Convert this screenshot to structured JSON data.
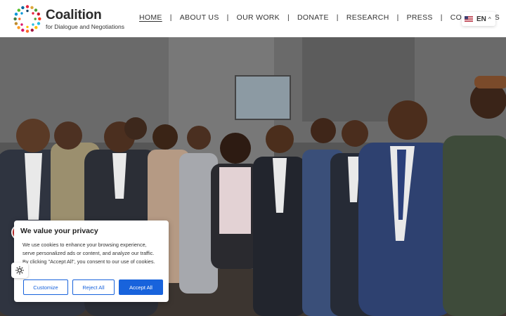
{
  "brand": {
    "title": "Coalition",
    "subtitle": "for Dialogue and Negotiations"
  },
  "nav": {
    "items": [
      {
        "label": "HOME",
        "active": true
      },
      {
        "label": "ABOUT US",
        "active": false
      },
      {
        "label": "OUR WORK",
        "active": false
      },
      {
        "label": "DONATE",
        "active": false
      },
      {
        "label": "RESEARCH",
        "active": false
      },
      {
        "label": "PRESS",
        "active": false
      },
      {
        "label": "CONTACT US",
        "active": false
      }
    ],
    "separator": "|"
  },
  "language": {
    "code": "EN",
    "flag_icon": "us-flag-icon",
    "chevron": "^"
  },
  "hero": {
    "image_subject": "group-photo"
  },
  "cookie_banner": {
    "title": "We value your privacy",
    "text": "We use cookies to enhance your browsing experience, serve personalized ads or content, and analyze our traffic. By clicking \"Accept All\", you consent to our use of cookies.",
    "buttons": {
      "customize": "Customize",
      "reject": "Reject All",
      "accept": "Accept All"
    }
  },
  "colors": {
    "accent": "#1863dc",
    "accessibility": "#c62828"
  }
}
